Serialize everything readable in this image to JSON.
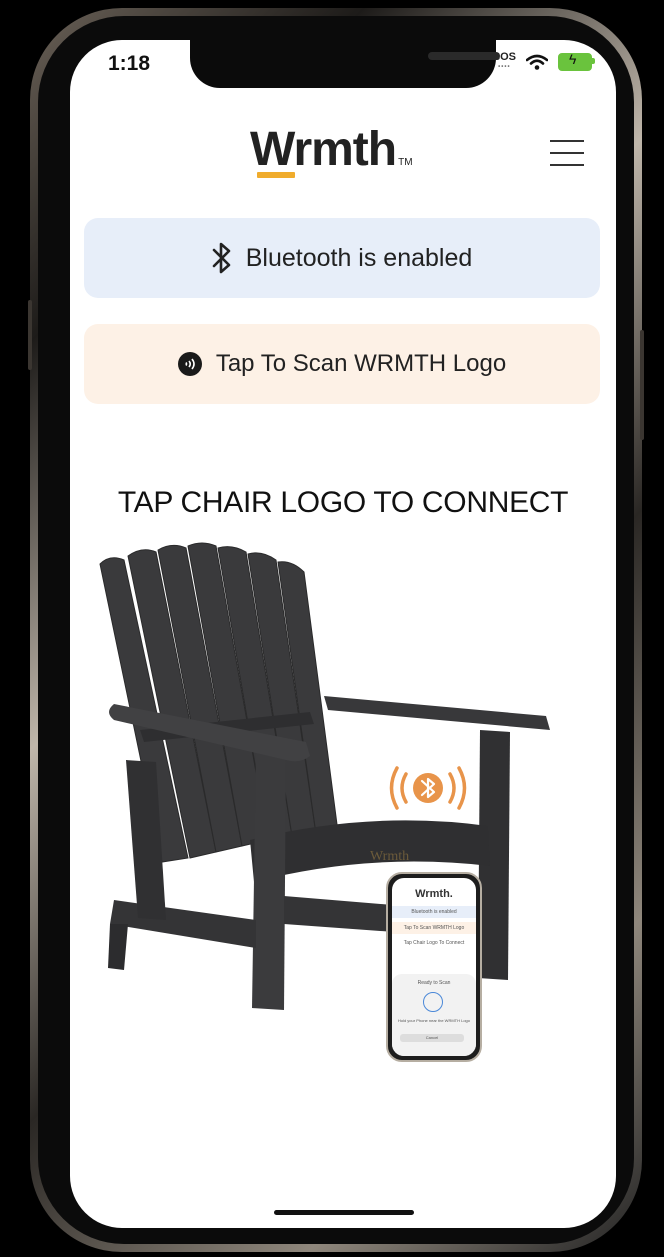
{
  "status_bar": {
    "time": "1:18",
    "sos": "SOS",
    "icons": [
      "wifi-icon",
      "battery-charging-icon"
    ]
  },
  "header": {
    "logo_text": "Wrmth",
    "logo_tm": "TM",
    "menu_icon": "hamburger-menu-icon"
  },
  "bluetooth_card": {
    "label": "Bluetooth is enabled",
    "icon": "bluetooth-icon"
  },
  "scan_card": {
    "label": "Tap To Scan WRMTH Logo",
    "icon": "nfc-icon"
  },
  "main": {
    "headline": "TAP CHAIR LOGO TO CONNECT",
    "chair_logo_text": "Wrmth"
  },
  "mini_phone": {
    "logo": "Wrmth.",
    "line1": "Bluetooth is enabled",
    "line2": "Tap To Scan WRMTH Logo",
    "line3": "Tap Chair Logo To Connect",
    "sheet_title": "Ready to Scan",
    "sheet_text": "Hold your Phone near the WRMTH Logo",
    "cancel": "Cancel"
  },
  "colors": {
    "accent": "#f0ac2c",
    "bluetooth_card_bg": "#e7eef9",
    "scan_card_bg": "#fdf1e6",
    "bluetooth_badge": "#e8944a"
  }
}
